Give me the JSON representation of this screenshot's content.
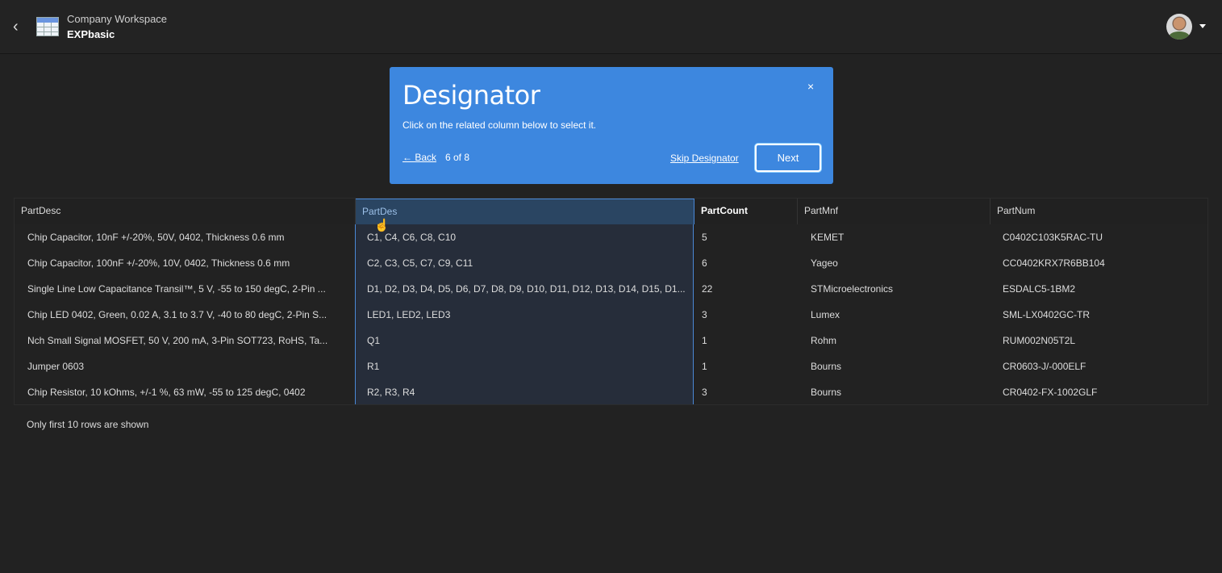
{
  "header": {
    "workspace": "Company Workspace",
    "project": "EXPbasic",
    "back_icon": "chevron-left-icon",
    "app_icon": "table-icon",
    "avatar_icon": "user-avatar",
    "menu_icon": "caret-down-icon"
  },
  "tour": {
    "title": "Designator",
    "subtitle": "Click on the related column below to select it.",
    "back_label": "← Back",
    "step": "6 of 8",
    "skip_label": "Skip Designator",
    "next_label": "Next",
    "close_label": "×",
    "color": "#3d87df"
  },
  "table": {
    "columns": [
      "PartDesc",
      "PartDes",
      "PartCount",
      "PartMnf",
      "PartNum"
    ],
    "selected_column": "PartDes",
    "rows": [
      [
        "Chip Capacitor, 10nF +/-20%, 50V, 0402, Thickness 0.6 mm",
        "C1, C4, C6, C8, C10",
        "5",
        "KEMET",
        "C0402C103K5RAC-TU"
      ],
      [
        "Chip Capacitor, 100nF +/-20%, 10V, 0402, Thickness 0.6 mm",
        "C2, C3, C5, C7, C9, C11",
        "6",
        "Yageo",
        "CC0402KRX7R6BB104"
      ],
      [
        "Single Line Low Capacitance Transil™, 5 V, -55 to 150 degC, 2-Pin ...",
        "D1, D2, D3, D4, D5, D6, D7, D8, D9, D10, D11, D12, D13, D14, D15, D1...",
        "22",
        "STMicroelectronics",
        "ESDALC5-1BM2"
      ],
      [
        "Chip LED 0402, Green, 0.02 A, 3.1 to 3.7 V, -40 to 80 degC, 2-Pin S...",
        "LED1, LED2, LED3",
        "3",
        "Lumex",
        "SML-LX0402GC-TR"
      ],
      [
        "Nch Small Signal MOSFET, 50 V, 200 mA, 3-Pin SOT723, RoHS, Ta...",
        "Q1",
        "1",
        "Rohm",
        "RUM002N05T2L"
      ],
      [
        "Jumper 0603",
        "R1",
        "1",
        "Bourns",
        "CR0603-J/-000ELF"
      ],
      [
        "Chip Resistor, 10 kOhms, +/-1 %, 63 mW, -55 to 125 degC, 0402",
        "R2, R3, R4",
        "3",
        "Bourns",
        "CR0402-FX-1002GLF"
      ]
    ],
    "note": "Only first 10 rows are shown"
  }
}
